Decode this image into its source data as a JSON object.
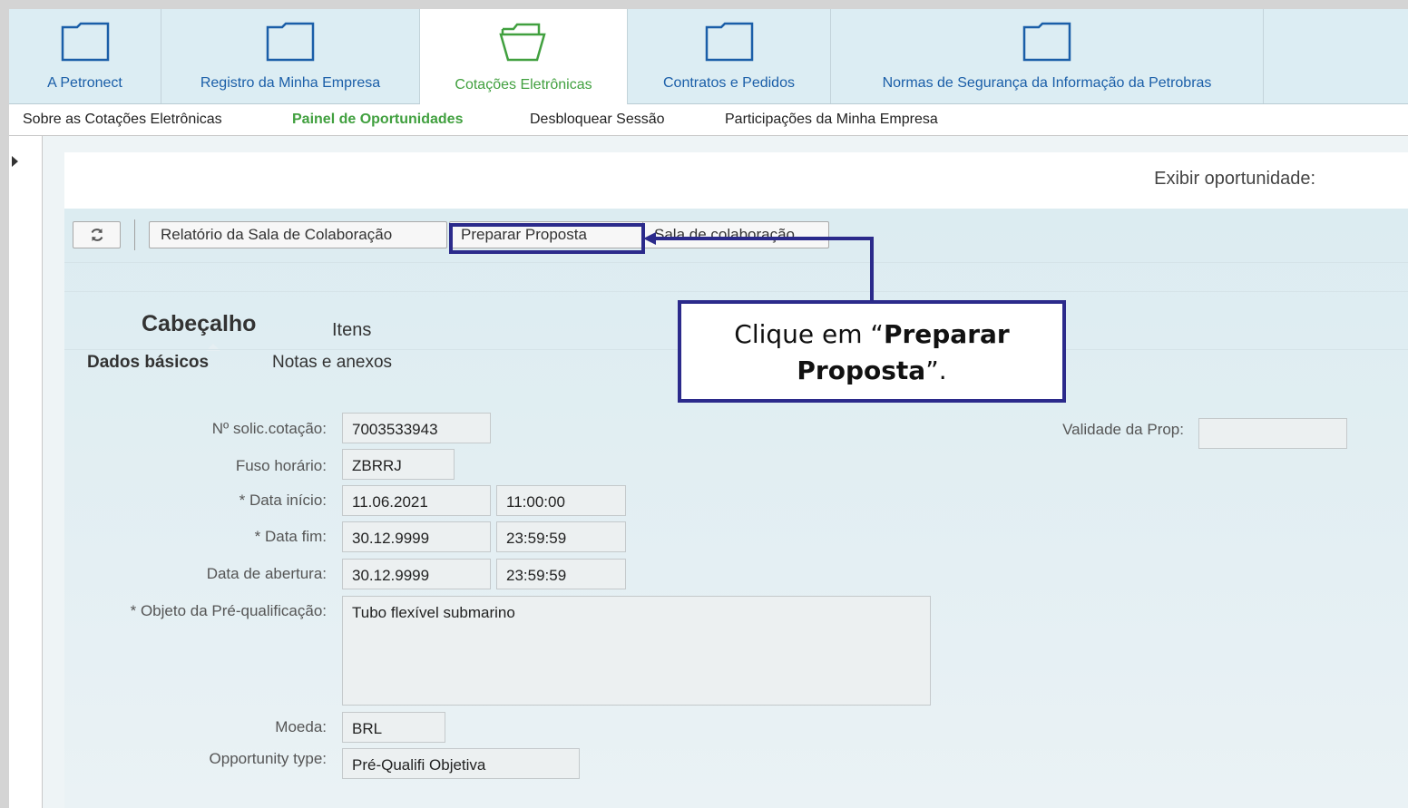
{
  "tabs": [
    {
      "label": "A Petronect",
      "icon": "folder-icon",
      "active": false
    },
    {
      "label": "Registro da Minha Empresa",
      "icon": "folder-icon",
      "active": false
    },
    {
      "label": "Cotações Eletrônicas",
      "icon": "folder-open-icon",
      "active": true
    },
    {
      "label": "Contratos e Pedidos",
      "icon": "folder-icon",
      "active": false
    },
    {
      "label": "Normas de Segurança da Informação da Petrobras",
      "icon": "folder-icon",
      "active": false
    }
  ],
  "subnav": [
    {
      "label": "Sobre as Cotações Eletrônicas",
      "active": false
    },
    {
      "label": "Painel de Oportunidades",
      "active": true
    },
    {
      "label": "Desbloquear Sessão",
      "active": false
    },
    {
      "label": "Participações da Minha Empresa",
      "active": false
    }
  ],
  "page": {
    "title": "Exibir oportunidade:"
  },
  "toolbar": {
    "refresh_icon": "refresh-icon",
    "report_label": "Relatório da Sala de Colaboração",
    "prepare_label": "Preparar Proposta",
    "collab_label": "Sala de colaboração"
  },
  "sections": {
    "header_label": "Cabeçalho",
    "items_label": "Itens",
    "basic_label": "Dados básicos",
    "notes_label": "Notas e anexos"
  },
  "form": {
    "rfq_label": "Nº solic.cotação:",
    "rfq_value": "7003533943",
    "tz_label": "Fuso horário:",
    "tz_value": "ZBRRJ",
    "start_label": "Data início:",
    "start_date": "11.06.2021",
    "start_time": "11:00:00",
    "end_label": "Data fim:",
    "end_date": "30.12.9999",
    "end_time": "23:59:59",
    "open_label": "Data de abertura:",
    "open_date": "30.12.9999",
    "open_time": "23:59:59",
    "object_label": "Objeto da Pré-qualificação:",
    "object_value": "Tubo flexível submarino",
    "currency_label": "Moeda:",
    "currency_value": "BRL",
    "type_label": "Opportunity type:",
    "type_value": "Pré-Qualifi Objetiva",
    "validity_label": "Validade da Prop:",
    "validity_value": "",
    "required_mark": "*"
  },
  "annotation": {
    "pre": "Clique em “",
    "bold": "Preparar Proposta",
    "post": "”."
  },
  "colors": {
    "accent_green": "#41a03f",
    "link_blue": "#1a5ea8",
    "annotation_navy": "#2b2a8b"
  }
}
